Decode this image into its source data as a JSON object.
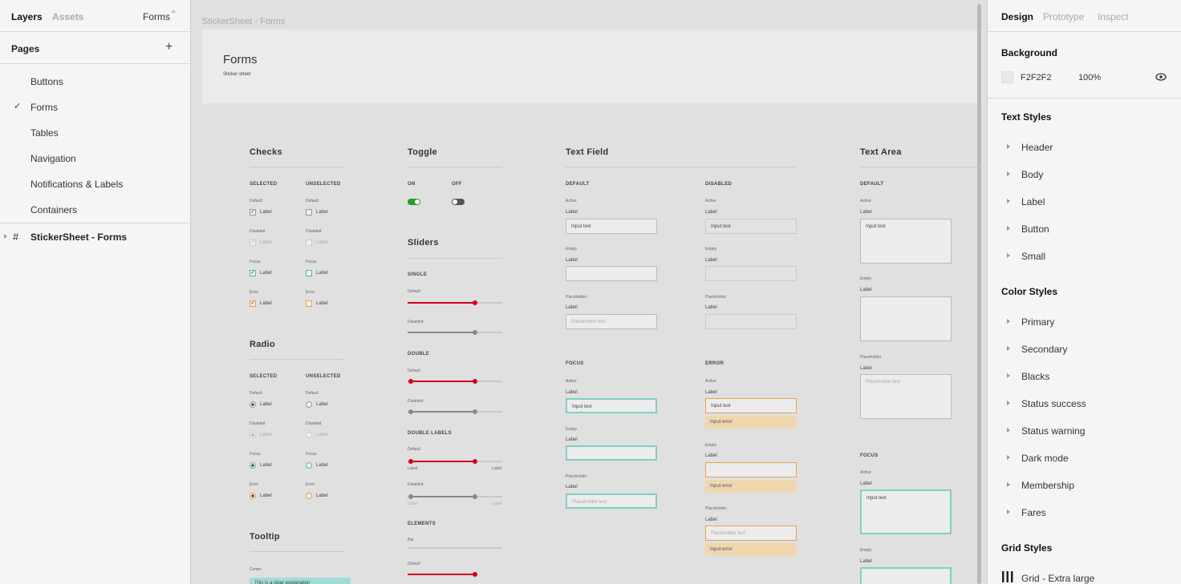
{
  "left_panel": {
    "tabs": {
      "layers": "Layers",
      "assets": "Assets",
      "page_selector": "Forms"
    },
    "pages_title": "Pages",
    "pages": [
      "Buttons",
      "Forms",
      "Tables",
      "Navigation",
      "Notifications & Labels",
      "Containers"
    ],
    "layers": [
      "StickerSheet - Forms"
    ]
  },
  "canvas": {
    "frame_label": "StickerSheet - Forms",
    "header_title": "Forms",
    "header_subtitle": "Sticker sheet",
    "checks": {
      "title": "Checks",
      "selected": "SELECTED",
      "unselected": "UNSELECTED",
      "states": [
        "Default",
        "Disabled",
        "Focus",
        "Error"
      ],
      "label": "Label"
    },
    "radio": {
      "title": "Radio",
      "selected": "SELECTED",
      "unselected": "UNSELECTED",
      "states": [
        "Default",
        "Disabled",
        "Focus",
        "Error"
      ],
      "label": "Label"
    },
    "tooltip": {
      "title": "Tooltip",
      "center": "Center",
      "text": "This is a clear explanation"
    },
    "toggle": {
      "title": "Toggle",
      "on": "ON",
      "off": "OFF"
    },
    "sliders": {
      "title": "Sliders",
      "single": "SINGLE",
      "double": "DOUBLE",
      "double_labels": "DOUBLE LABELS",
      "elements": "ELEMENTS",
      "default": "Default",
      "disabled": "Disabled",
      "bar": "Bar",
      "label": "Label"
    },
    "text_field": {
      "title": "Text Field",
      "default": "DEFAULT",
      "disabled": "DISABLED",
      "focus": "FOCUS",
      "error": "ERROR",
      "active": "Active",
      "empty": "Empty",
      "placeholder": "Placeholder",
      "label": "Label",
      "input_text": "Input text",
      "placeholder_text": "Placeholder text",
      "input_error": "Input error"
    },
    "text_area": {
      "title": "Text Area",
      "default": "DEFAULT",
      "focus": "FOCUS",
      "active": "Active",
      "empty": "Empty",
      "placeholder": "Placeholder",
      "label": "Label",
      "input_text": "Input text",
      "placeholder_text": "Placeholder text"
    }
  },
  "right_panel": {
    "tabs": {
      "design": "Design",
      "prototype": "Prototype",
      "inspect": "Inspect"
    },
    "background": {
      "title": "Background",
      "hex": "F2F2F2",
      "opacity": "100%"
    },
    "text_styles": {
      "title": "Text Styles",
      "items": [
        "Header",
        "Body",
        "Label",
        "Button",
        "Small"
      ]
    },
    "color_styles": {
      "title": "Color Styles",
      "items": [
        "Primary",
        "Secondary",
        "Blacks",
        "Status success",
        "Status warning",
        "Dark mode",
        "Membership",
        "Fares"
      ]
    },
    "grid_styles": {
      "title": "Grid Styles",
      "items": [
        "Grid - Extra large"
      ]
    }
  },
  "colors": {
    "primary": "#d0021b",
    "success": "#2a9d2a",
    "focus": "#7fcfc8",
    "error": "#e8a34a",
    "error_bg": "#efd7b0"
  }
}
